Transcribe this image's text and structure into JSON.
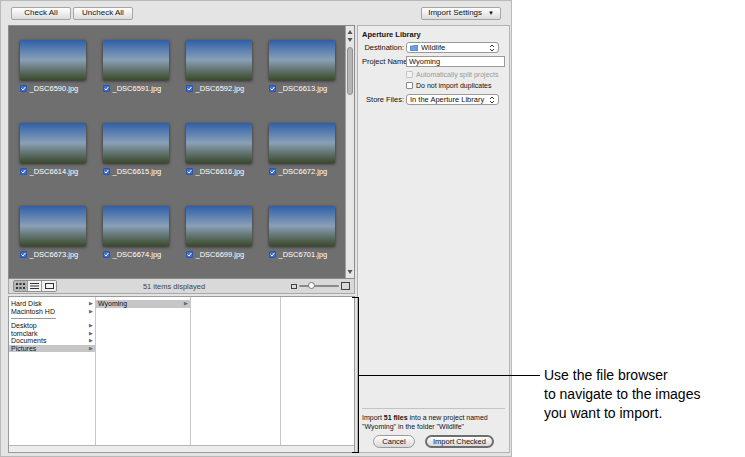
{
  "toolbar": {
    "buttons": [
      {
        "label": "Check All"
      },
      {
        "label": "Uncheck All"
      }
    ],
    "settings_menu": {
      "label": "Import Settings",
      "arrow": "▼"
    }
  },
  "thumbnails": [
    {
      "name": "_DSC6590.jpg",
      "checked": true
    },
    {
      "name": "_DSC6591.jpg",
      "checked": true
    },
    {
      "name": "_DSC6592.jpg",
      "checked": true
    },
    {
      "name": "_DSC6613.jpg",
      "checked": true
    },
    {
      "name": "_DSC6614.jpg",
      "checked": true
    },
    {
      "name": "_DSC6615.jpg",
      "checked": true
    },
    {
      "name": "_DSC6616.jpg",
      "checked": true
    },
    {
      "name": "_DSC6672.jpg",
      "checked": true
    },
    {
      "name": "_DSC6673.jpg",
      "checked": true
    },
    {
      "name": "_DSC6674.jpg",
      "checked": true
    },
    {
      "name": "_DSC6699.jpg",
      "checked": true
    },
    {
      "name": "_DSC6701.jpg",
      "checked": true
    }
  ],
  "browser_bar": {
    "views": [
      {
        "kind": "grid",
        "selected": true
      },
      {
        "kind": "list",
        "selected": false
      },
      {
        "kind": "filmstrip",
        "selected": false
      }
    ],
    "count": "51 items displayed",
    "zoom_level": 0.3
  },
  "file_browser": {
    "columns": [
      {
        "items": [
          {
            "label": "Hard Disk",
            "arrow": "▶",
            "selected": false,
            "separator_after": false
          },
          {
            "label": "Macintosh HD",
            "arrow": "▶",
            "selected": false,
            "separator_after": true
          },
          {
            "label": "Desktop",
            "arrow": "▶",
            "selected": false,
            "separator_after": false
          },
          {
            "label": "tomclark",
            "arrow": "▶",
            "selected": false,
            "separator_after": false
          },
          {
            "label": "Documents",
            "arrow": "▶",
            "selected": false,
            "separator_after": false
          },
          {
            "label": "Pictures",
            "arrow": "▶",
            "selected": true,
            "separator_after": false
          }
        ]
      },
      {
        "items": [
          {
            "label": "Wyoming",
            "arrow": "▶",
            "selected": true,
            "separator_after": false
          }
        ]
      },
      {
        "items": []
      },
      {
        "items": []
      }
    ]
  },
  "import_panel": {
    "heading": "Aperture Library",
    "destination": {
      "label": "Destination:",
      "value": "Wildlife"
    },
    "project_name": {
      "label": "Project Name:",
      "value": "Wyoming"
    },
    "options": [
      {
        "label": "Automatically split projects",
        "checked": false,
        "disabled": true
      },
      {
        "label": "Do not import duplicates",
        "checked": false,
        "disabled": false
      }
    ],
    "store_files": {
      "label": "Store Files:",
      "value": "In the Aperture Library"
    }
  },
  "summary": {
    "before": "Import ",
    "bold": "51 files",
    "after": " into a new project named \"Wyoming\" in the folder \"Wildlife\""
  },
  "buttons": [
    {
      "label": "Cancel",
      "default": false
    },
    {
      "label": "Import Checked",
      "default": true
    }
  ],
  "callout": {
    "lines": [
      "Use the file browser",
      "to navigate to the images",
      "you want to import."
    ]
  }
}
